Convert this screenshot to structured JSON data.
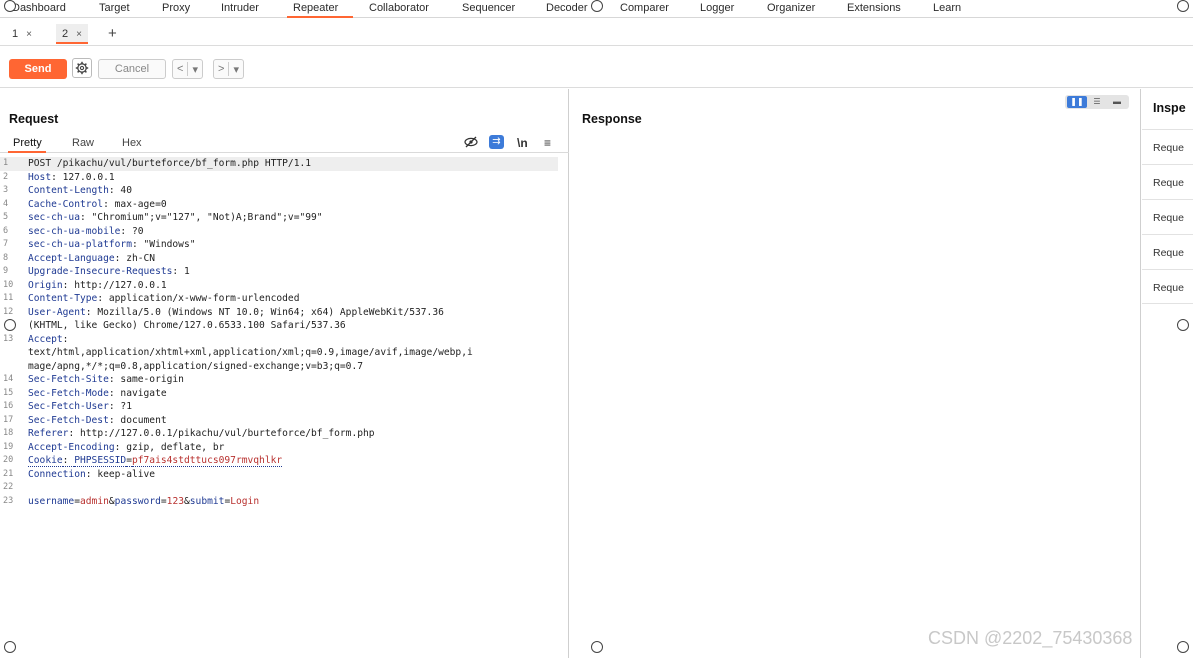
{
  "nav": {
    "items": [
      "Dashboard",
      "Target",
      "Proxy",
      "Intruder",
      "Repeater",
      "Collaborator",
      "Sequencer",
      "Decoder",
      "Comparer",
      "Logger",
      "Organizer",
      "Extensions",
      "Learn"
    ],
    "active": "Repeater"
  },
  "tabs": {
    "items": [
      {
        "label": "1",
        "close": "×"
      },
      {
        "label": "2",
        "close": "×"
      }
    ],
    "add": "+"
  },
  "toolbar": {
    "send_label": "Send",
    "cancel_label": "Cancel",
    "back": "<",
    "forward": ">",
    "dropdown": "▾",
    "gear_icon": "gear-icon"
  },
  "request": {
    "title": "Request",
    "subtabs": [
      "Pretty",
      "Raw",
      "Hex"
    ],
    "active_subtab": "Pretty",
    "icons": [
      "hide-icon",
      "wrap-icon",
      "newline-icon",
      "menu-icon"
    ],
    "newline_label": "\\n",
    "lines": [
      {
        "n": "1",
        "parts": [
          [
            "hv",
            "POST /pikachu/vul/burteforce/bf_form.php HTTP/1.1"
          ]
        ]
      },
      {
        "n": "2",
        "parts": [
          [
            "hk",
            "Host"
          ],
          [
            "hv",
            ": 127.0.0.1"
          ]
        ]
      },
      {
        "n": "3",
        "parts": [
          [
            "hk",
            "Content-Length"
          ],
          [
            "hv",
            ": 40"
          ]
        ]
      },
      {
        "n": "4",
        "parts": [
          [
            "hk",
            "Cache-Control"
          ],
          [
            "hv",
            ": max-age=0"
          ]
        ]
      },
      {
        "n": "5",
        "parts": [
          [
            "hk",
            "sec-ch-ua"
          ],
          [
            "hv",
            ": \"Chromium\";v=\"127\", \"Not)A;Brand\";v=\"99\""
          ]
        ]
      },
      {
        "n": "6",
        "parts": [
          [
            "hk",
            "sec-ch-ua-mobile"
          ],
          [
            "hv",
            ": ?0"
          ]
        ]
      },
      {
        "n": "7",
        "parts": [
          [
            "hk",
            "sec-ch-ua-platform"
          ],
          [
            "hv",
            ": \"Windows\""
          ]
        ]
      },
      {
        "n": "8",
        "parts": [
          [
            "hk",
            "Accept-Language"
          ],
          [
            "hv",
            ": zh-CN"
          ]
        ]
      },
      {
        "n": "9",
        "parts": [
          [
            "hk",
            "Upgrade-Insecure-Requests"
          ],
          [
            "hv",
            ": 1"
          ]
        ]
      },
      {
        "n": "10",
        "parts": [
          [
            "hk",
            "Origin"
          ],
          [
            "hv",
            ": http://127.0.0.1"
          ]
        ]
      },
      {
        "n": "11",
        "parts": [
          [
            "hk",
            "Content-Type"
          ],
          [
            "hv",
            ": application/x-www-form-urlencoded"
          ]
        ]
      },
      {
        "n": "12",
        "parts": [
          [
            "hk",
            "User-Agent"
          ],
          [
            "hv",
            ": Mozilla/5.0 (Windows NT 10.0; Win64; x64) AppleWebKit/537.36"
          ]
        ]
      },
      {
        "n": "",
        "parts": [
          [
            "hv",
            "(KHTML, like Gecko) Chrome/127.0.6533.100 Safari/537.36"
          ]
        ]
      },
      {
        "n": "13",
        "parts": [
          [
            "hk",
            "Accept"
          ],
          [
            "hv",
            ":"
          ]
        ]
      },
      {
        "n": "",
        "parts": [
          [
            "hv",
            "text/html,application/xhtml+xml,application/xml;q=0.9,image/avif,image/webp,i"
          ]
        ]
      },
      {
        "n": "",
        "parts": [
          [
            "hv",
            "mage/apng,*/*;q=0.8,application/signed-exchange;v=b3;q=0.7"
          ]
        ]
      },
      {
        "n": "14",
        "parts": [
          [
            "hk",
            "Sec-Fetch-Site"
          ],
          [
            "hv",
            ": same-origin"
          ]
        ]
      },
      {
        "n": "15",
        "parts": [
          [
            "hk",
            "Sec-Fetch-Mode"
          ],
          [
            "hv",
            ": navigate"
          ]
        ]
      },
      {
        "n": "16",
        "parts": [
          [
            "hk",
            "Sec-Fetch-User"
          ],
          [
            "hv",
            ": ?1"
          ]
        ]
      },
      {
        "n": "17",
        "parts": [
          [
            "hk",
            "Sec-Fetch-Dest"
          ],
          [
            "hv",
            ": document"
          ]
        ]
      },
      {
        "n": "18",
        "parts": [
          [
            "hk",
            "Referer"
          ],
          [
            "hv",
            ": http://127.0.0.1/pikachu/vul/burteforce/bf_form.php"
          ]
        ]
      },
      {
        "n": "19",
        "parts": [
          [
            "hk",
            "Accept-Encoding"
          ],
          [
            "hv",
            ": gzip, deflate, br"
          ]
        ]
      },
      {
        "n": "20",
        "parts": [
          [
            "hk",
            "Cookie"
          ],
          [
            "hv",
            ": "
          ],
          [
            "hk",
            "PHPSESSID"
          ],
          [
            "hv",
            "="
          ],
          [
            "cv",
            "pf7ais4stdttucs097rmvqhlkr"
          ]
        ]
      },
      {
        "n": "21",
        "parts": [
          [
            "hk",
            "Connection"
          ],
          [
            "hv",
            ": keep-alive"
          ]
        ]
      },
      {
        "n": "22",
        "parts": []
      },
      {
        "n": "23",
        "parts": [
          [
            "pk",
            "username"
          ],
          [
            "hv",
            "="
          ],
          [
            "pv",
            "admin"
          ],
          [
            "hv",
            "&"
          ],
          [
            "pk",
            "password"
          ],
          [
            "hv",
            "="
          ],
          [
            "pv",
            "123"
          ],
          [
            "hv",
            "&"
          ],
          [
            "pk",
            "submit"
          ],
          [
            "hv",
            "="
          ],
          [
            "pv",
            "Login"
          ]
        ]
      }
    ]
  },
  "response": {
    "title": "Response"
  },
  "inspector": {
    "title": "Inspe",
    "rows": [
      "Reque",
      "Reque",
      "Reque",
      "Reque",
      "Reque"
    ]
  },
  "watermark": "CSDN @2202_75430368",
  "colors": {
    "accent": "#ff6633",
    "blue": "#3d7bd9",
    "header_key": "#1f3a93",
    "value_red": "#b8312f"
  }
}
